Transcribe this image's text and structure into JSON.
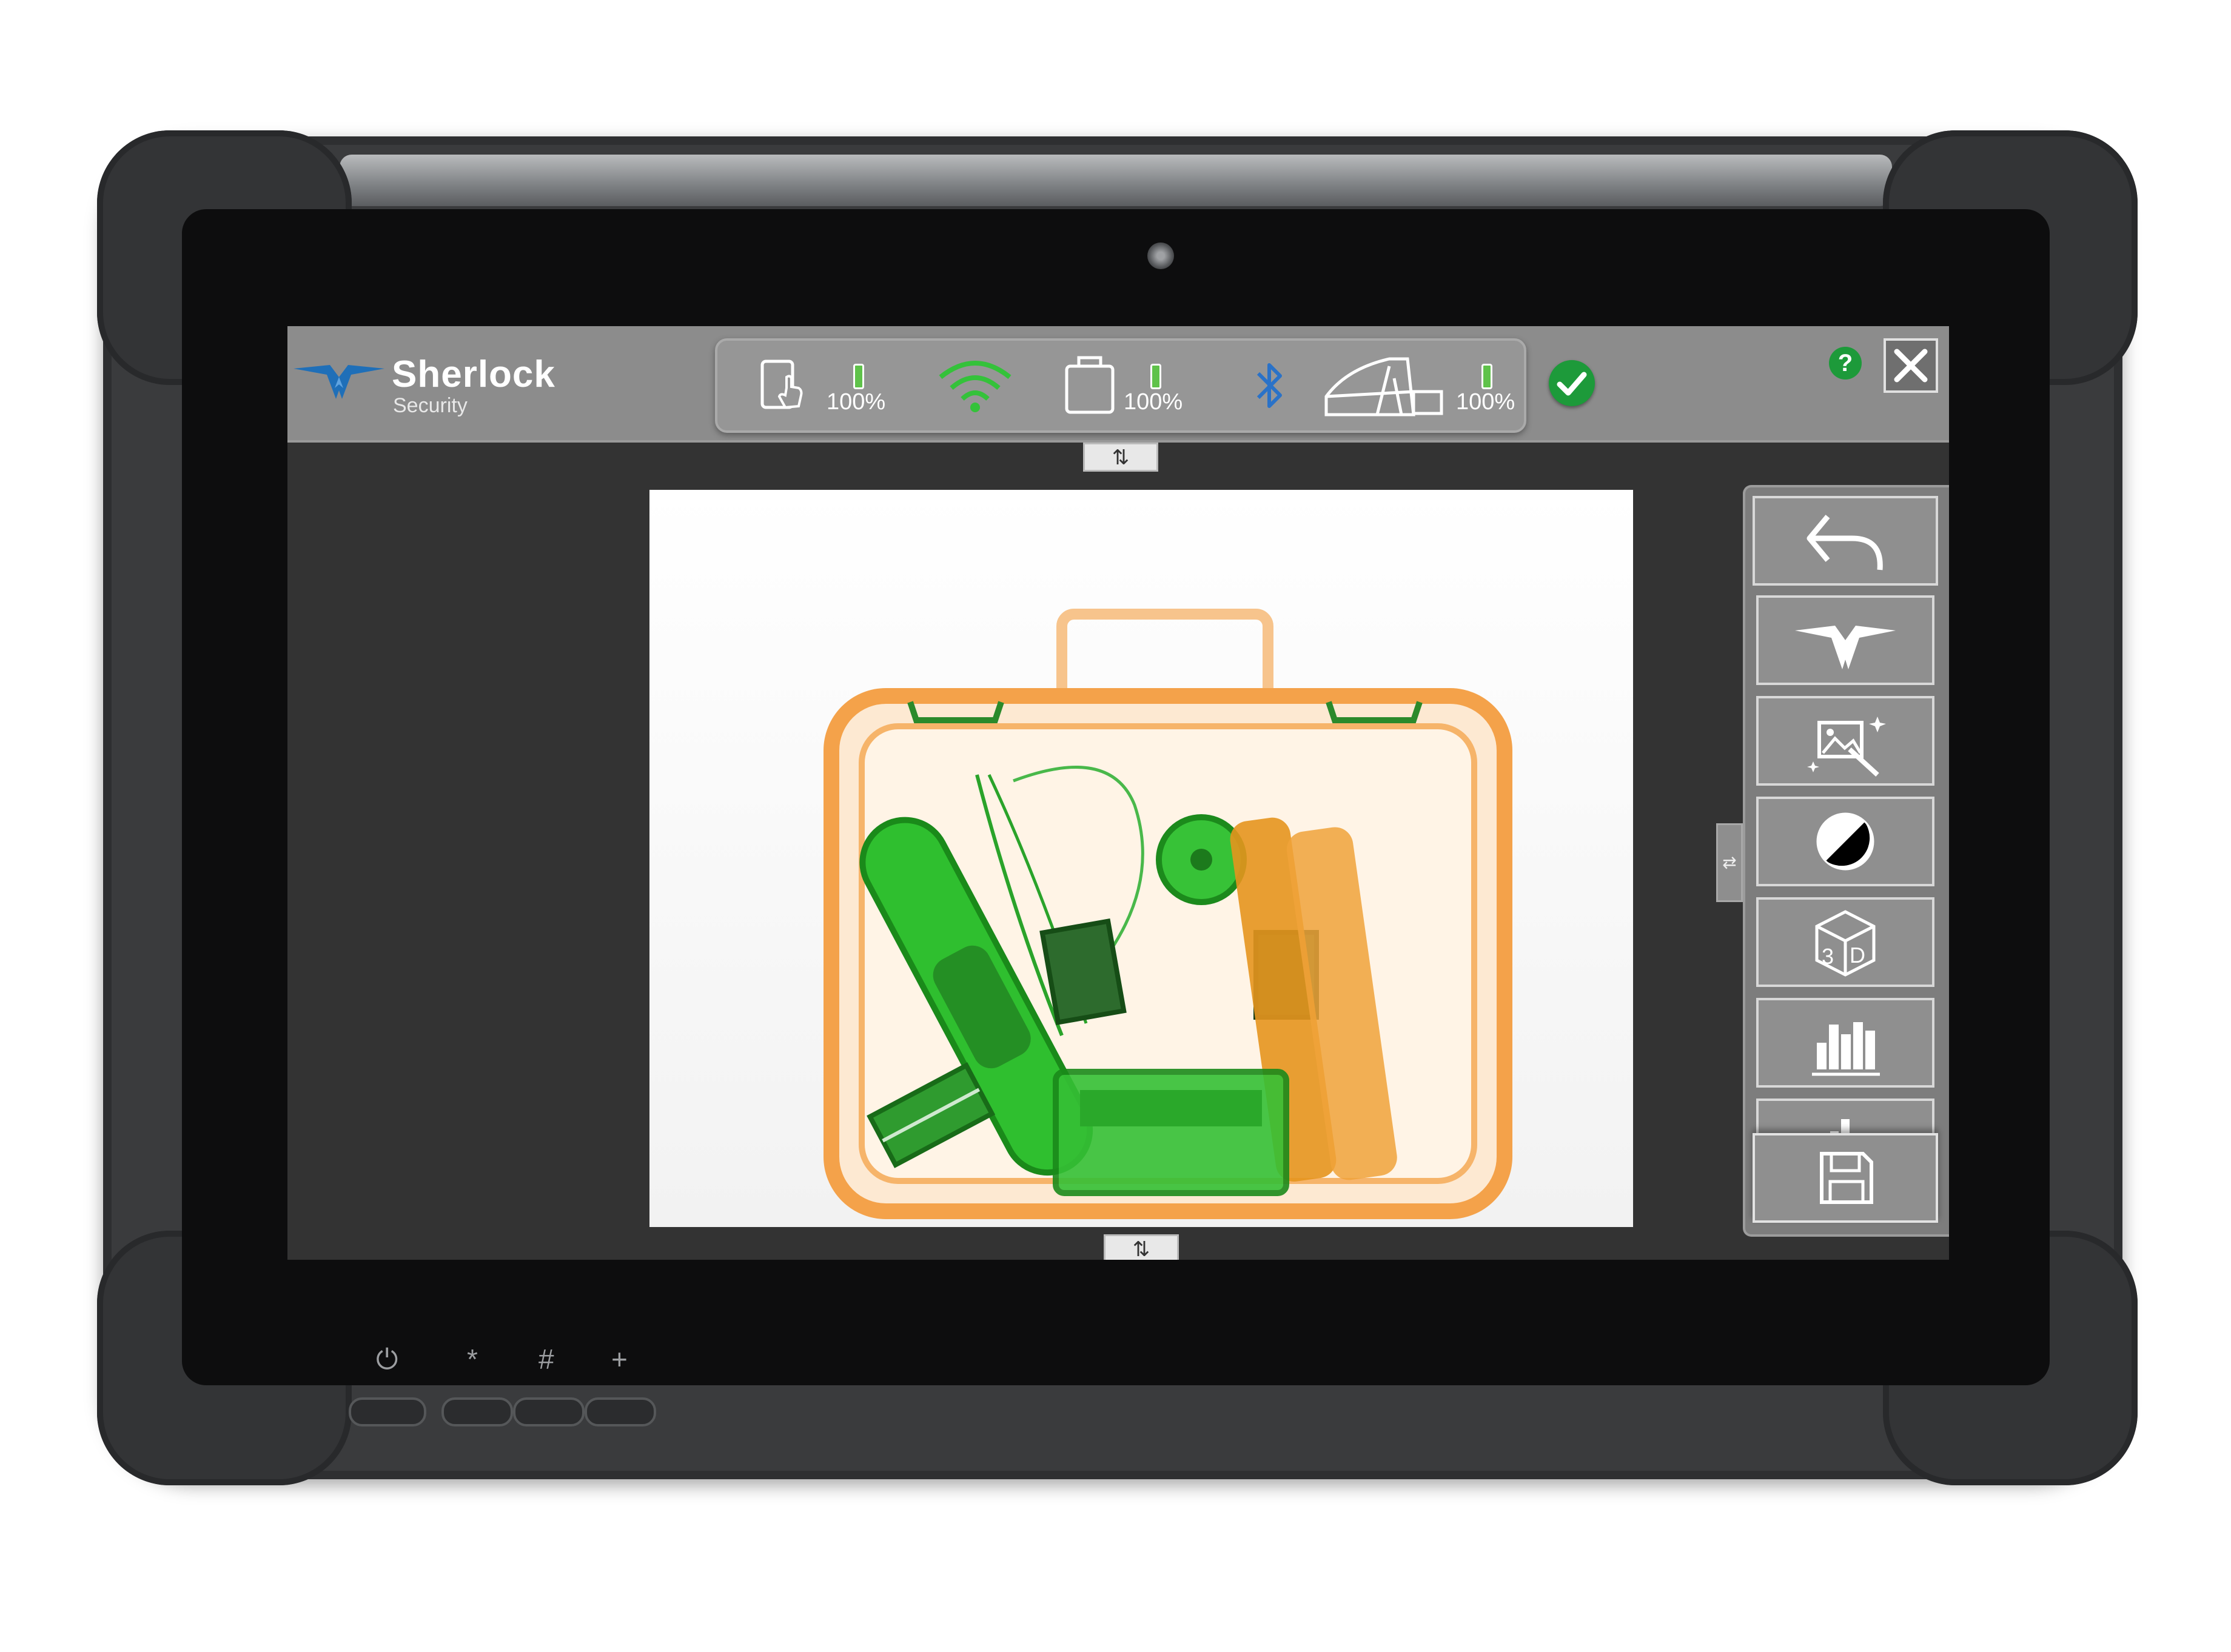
{
  "app": {
    "brand_name": "Sherlock",
    "brand_subtitle": "Security"
  },
  "status_bar": {
    "items": [
      {
        "icon": "tablet-touch-icon",
        "value": "100%"
      },
      {
        "icon": "wifi-icon"
      },
      {
        "icon": "battery-case-icon",
        "value": "100%"
      },
      {
        "icon": "bluetooth-icon"
      },
      {
        "icon": "xray-scanner-icon",
        "value": "100%"
      }
    ],
    "system_status_icon": "check-icon",
    "help_label": "?"
  },
  "handles": {
    "top_label": "⇅",
    "bottom_label": "⇅",
    "side_label": "⇄"
  },
  "toolbar": {
    "tools": [
      "back-icon",
      "teledyne-logo-icon",
      "image-enhance-icon",
      "contrast-icon",
      "3d-cube-icon",
      "histogram-icon",
      "partial-histogram-icon"
    ],
    "save_icon": "save-icon"
  },
  "hardware": {
    "button_labels": [
      "⏻",
      "*",
      "#",
      "+"
    ]
  },
  "colors": {
    "topbar": "#8c8c8c",
    "accent_green": "#1d9a3a",
    "battery_green": "#5fc24a",
    "bluetooth_blue": "#2a72c8",
    "logo_blue": "#1f6fb8",
    "xray_organic": "#f4a24a",
    "xray_inorganic": "#27b226"
  }
}
